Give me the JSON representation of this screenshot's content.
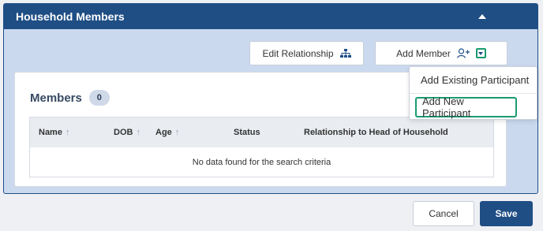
{
  "panel": {
    "title": "Household Members",
    "collapse_icon": "caret-up-icon"
  },
  "toolbar": {
    "edit_relationship_label": "Edit Relationship",
    "edit_relationship_icon": "hierarchy-icon",
    "add_member_label": "Add Member",
    "add_member_icon": "add-user-icon",
    "add_member_toggle_icon": "caret-down-icon"
  },
  "members": {
    "heading": "Members",
    "count": "0",
    "columns": [
      {
        "label": "Name",
        "sortable": true
      },
      {
        "label": "DOB",
        "sortable": true
      },
      {
        "label": "Age",
        "sortable": true
      },
      {
        "label": "Status",
        "sortable": false
      },
      {
        "label": "Relationship to Head of Household",
        "sortable": false
      }
    ],
    "sort_indicator": "↑",
    "empty_message": "No data found for the search criteria"
  },
  "dropdown": {
    "items": [
      "Add Existing Participant",
      "Add New Participant"
    ],
    "highlighted_index": 1
  },
  "footer": {
    "cancel_label": "Cancel",
    "save_label": "Save"
  },
  "colors": {
    "header": "#1f4e85",
    "panel_bg": "#cbd9ef",
    "focus_outline": "#1a9b72"
  }
}
